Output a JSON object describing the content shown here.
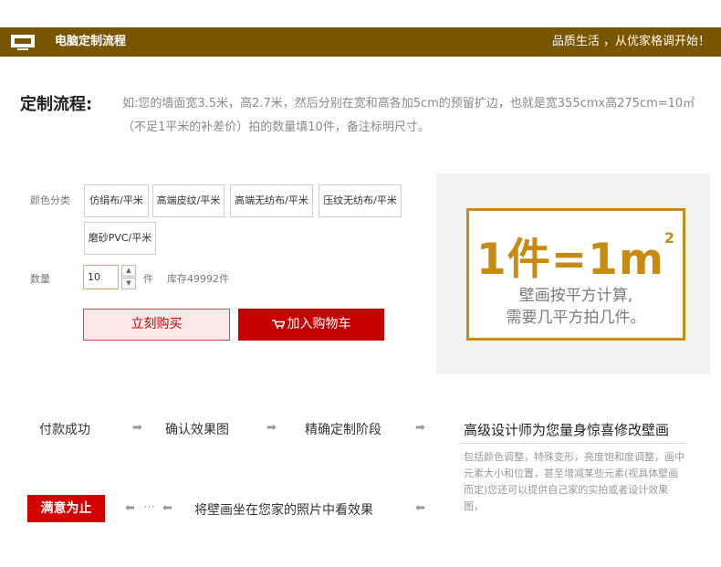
{
  "header": {
    "title": "电脑定制流程",
    "slogan": "品质生活 ，从优家格调开始！"
  },
  "process": {
    "label": "定制流程:",
    "description": "如:您的墙面宽3.5米，高2.7米，然后分别在宽和高各加5cm的预留扩边，也就是宽355cmx高275cm=10㎡（不足1平米的补差价）拍的数量填10件，备注标明尺寸。"
  },
  "options": {
    "color_label": "颜色分类",
    "items": [
      "仿绢布/平米",
      "高端皮纹/平米",
      "高端无纺布/平米",
      "压纹无纺布/平米",
      "磨砂PVC/平米"
    ]
  },
  "quantity": {
    "label": "数量",
    "value": "10",
    "unit": "件",
    "stock": "库存49992件",
    "up_symbol": "▲",
    "down_symbol": "▼"
  },
  "actions": {
    "buy_now": "立刻购买",
    "add_to_cart": "加入购物车"
  },
  "promo": {
    "formula": "1件=1m",
    "superscript": "2",
    "line1": "壁画按平方计算,",
    "line2": "需要几平方拍几件。"
  },
  "flow": {
    "step1": "付款成功",
    "step2": "确认效果图",
    "step3": "精确定制阶段",
    "step4": "高级设计师为您量身惊喜修改壁画",
    "step4_note": "包括颜色调整，特殊变形，亮度饱和度调整，画中元素大小和位置，甚至增减某些元素(视具体壁画而定)您还可以提供自己家的实拍或者设计效果图，",
    "step5": "将壁画坐在您家的照片中看效果",
    "final": "满意为止",
    "arrow": "➡",
    "back_arrow": "⬅",
    "ellipsis": "⋯"
  },
  "colors": {
    "header_bg": "#7a5500",
    "accent_gold": "#c88a10",
    "primary_red": "#c40000"
  }
}
